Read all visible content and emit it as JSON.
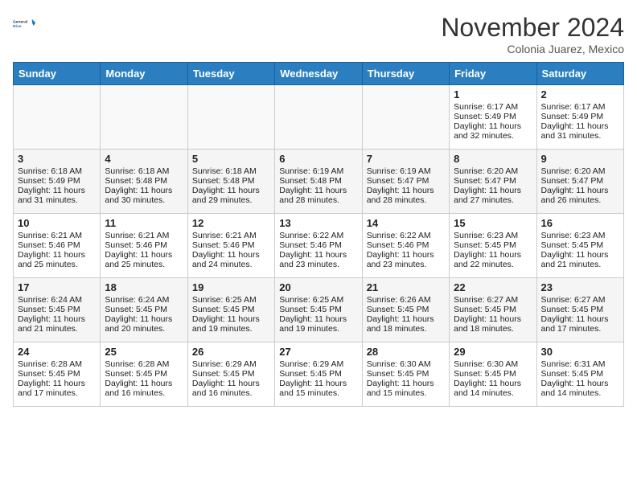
{
  "header": {
    "logo_line1": "General",
    "logo_line2": "Blue",
    "month_title": "November 2024",
    "subtitle": "Colonia Juarez, Mexico"
  },
  "days_of_week": [
    "Sunday",
    "Monday",
    "Tuesday",
    "Wednesday",
    "Thursday",
    "Friday",
    "Saturday"
  ],
  "weeks": [
    [
      {
        "day": "",
        "info": ""
      },
      {
        "day": "",
        "info": ""
      },
      {
        "day": "",
        "info": ""
      },
      {
        "day": "",
        "info": ""
      },
      {
        "day": "",
        "info": ""
      },
      {
        "day": "1",
        "info": "Sunrise: 6:17 AM\nSunset: 5:49 PM\nDaylight: 11 hours\nand 32 minutes."
      },
      {
        "day": "2",
        "info": "Sunrise: 6:17 AM\nSunset: 5:49 PM\nDaylight: 11 hours\nand 31 minutes."
      }
    ],
    [
      {
        "day": "3",
        "info": "Sunrise: 6:18 AM\nSunset: 5:49 PM\nDaylight: 11 hours\nand 31 minutes."
      },
      {
        "day": "4",
        "info": "Sunrise: 6:18 AM\nSunset: 5:48 PM\nDaylight: 11 hours\nand 30 minutes."
      },
      {
        "day": "5",
        "info": "Sunrise: 6:18 AM\nSunset: 5:48 PM\nDaylight: 11 hours\nand 29 minutes."
      },
      {
        "day": "6",
        "info": "Sunrise: 6:19 AM\nSunset: 5:48 PM\nDaylight: 11 hours\nand 28 minutes."
      },
      {
        "day": "7",
        "info": "Sunrise: 6:19 AM\nSunset: 5:47 PM\nDaylight: 11 hours\nand 28 minutes."
      },
      {
        "day": "8",
        "info": "Sunrise: 6:20 AM\nSunset: 5:47 PM\nDaylight: 11 hours\nand 27 minutes."
      },
      {
        "day": "9",
        "info": "Sunrise: 6:20 AM\nSunset: 5:47 PM\nDaylight: 11 hours\nand 26 minutes."
      }
    ],
    [
      {
        "day": "10",
        "info": "Sunrise: 6:21 AM\nSunset: 5:46 PM\nDaylight: 11 hours\nand 25 minutes."
      },
      {
        "day": "11",
        "info": "Sunrise: 6:21 AM\nSunset: 5:46 PM\nDaylight: 11 hours\nand 25 minutes."
      },
      {
        "day": "12",
        "info": "Sunrise: 6:21 AM\nSunset: 5:46 PM\nDaylight: 11 hours\nand 24 minutes."
      },
      {
        "day": "13",
        "info": "Sunrise: 6:22 AM\nSunset: 5:46 PM\nDaylight: 11 hours\nand 23 minutes."
      },
      {
        "day": "14",
        "info": "Sunrise: 6:22 AM\nSunset: 5:46 PM\nDaylight: 11 hours\nand 23 minutes."
      },
      {
        "day": "15",
        "info": "Sunrise: 6:23 AM\nSunset: 5:45 PM\nDaylight: 11 hours\nand 22 minutes."
      },
      {
        "day": "16",
        "info": "Sunrise: 6:23 AM\nSunset: 5:45 PM\nDaylight: 11 hours\nand 21 minutes."
      }
    ],
    [
      {
        "day": "17",
        "info": "Sunrise: 6:24 AM\nSunset: 5:45 PM\nDaylight: 11 hours\nand 21 minutes."
      },
      {
        "day": "18",
        "info": "Sunrise: 6:24 AM\nSunset: 5:45 PM\nDaylight: 11 hours\nand 20 minutes."
      },
      {
        "day": "19",
        "info": "Sunrise: 6:25 AM\nSunset: 5:45 PM\nDaylight: 11 hours\nand 19 minutes."
      },
      {
        "day": "20",
        "info": "Sunrise: 6:25 AM\nSunset: 5:45 PM\nDaylight: 11 hours\nand 19 minutes."
      },
      {
        "day": "21",
        "info": "Sunrise: 6:26 AM\nSunset: 5:45 PM\nDaylight: 11 hours\nand 18 minutes."
      },
      {
        "day": "22",
        "info": "Sunrise: 6:27 AM\nSunset: 5:45 PM\nDaylight: 11 hours\nand 18 minutes."
      },
      {
        "day": "23",
        "info": "Sunrise: 6:27 AM\nSunset: 5:45 PM\nDaylight: 11 hours\nand 17 minutes."
      }
    ],
    [
      {
        "day": "24",
        "info": "Sunrise: 6:28 AM\nSunset: 5:45 PM\nDaylight: 11 hours\nand 17 minutes."
      },
      {
        "day": "25",
        "info": "Sunrise: 6:28 AM\nSunset: 5:45 PM\nDaylight: 11 hours\nand 16 minutes."
      },
      {
        "day": "26",
        "info": "Sunrise: 6:29 AM\nSunset: 5:45 PM\nDaylight: 11 hours\nand 16 minutes."
      },
      {
        "day": "27",
        "info": "Sunrise: 6:29 AM\nSunset: 5:45 PM\nDaylight: 11 hours\nand 15 minutes."
      },
      {
        "day": "28",
        "info": "Sunrise: 6:30 AM\nSunset: 5:45 PM\nDaylight: 11 hours\nand 15 minutes."
      },
      {
        "day": "29",
        "info": "Sunrise: 6:30 AM\nSunset: 5:45 PM\nDaylight: 11 hours\nand 14 minutes."
      },
      {
        "day": "30",
        "info": "Sunrise: 6:31 AM\nSunset: 5:45 PM\nDaylight: 11 hours\nand 14 minutes."
      }
    ]
  ]
}
